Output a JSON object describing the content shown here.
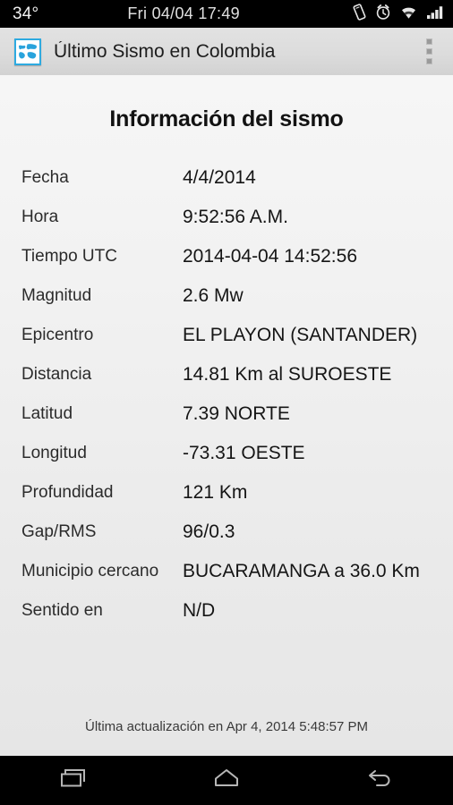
{
  "status_bar": {
    "temperature": "34°",
    "clock": "Fri 04/04 17:49",
    "icons": [
      "vibrate-icon",
      "alarm-icon",
      "wifi-icon",
      "signal-icon"
    ]
  },
  "action_bar": {
    "app_icon": "globe-app-icon",
    "title": "Último Sismo en Colombia",
    "overflow_label": "overflow-menu",
    "accent_color": "#2eaae0",
    "background_color": "#dcdcdc"
  },
  "main": {
    "page_title": "Información del sismo",
    "rows": [
      {
        "label": "Fecha",
        "value": "4/4/2014"
      },
      {
        "label": "Hora",
        "value": "9:52:56 A.M."
      },
      {
        "label": "Tiempo UTC",
        "value": "2014-04-04 14:52:56"
      },
      {
        "label": "Magnitud",
        "value": "2.6 Mw"
      },
      {
        "label": "Epicentro",
        "value": "EL PLAYON (SANTANDER)"
      },
      {
        "label": "Distancia",
        "value": "14.81 Km al SUROESTE"
      },
      {
        "label": "Latitud",
        "value": "7.39 NORTE"
      },
      {
        "label": "Longitud",
        "value": "-73.31 OESTE"
      },
      {
        "label": "Profundidad",
        "value": "121 Km"
      },
      {
        "label": "Gap/RMS",
        "value": "96/0.3"
      },
      {
        "label": "Municipio cercano",
        "value": "BUCARAMANGA a 36.0 Km"
      },
      {
        "label": "Sentido en",
        "value": "N/D"
      }
    ],
    "footer_note": "Última actualización en Apr 4, 2014 5:48:57 PM"
  },
  "nav_bar": {
    "buttons": [
      {
        "name": "recents-button",
        "icon": "recents-icon"
      },
      {
        "name": "home-button",
        "icon": "home-icon"
      },
      {
        "name": "back-button",
        "icon": "back-icon"
      }
    ]
  }
}
